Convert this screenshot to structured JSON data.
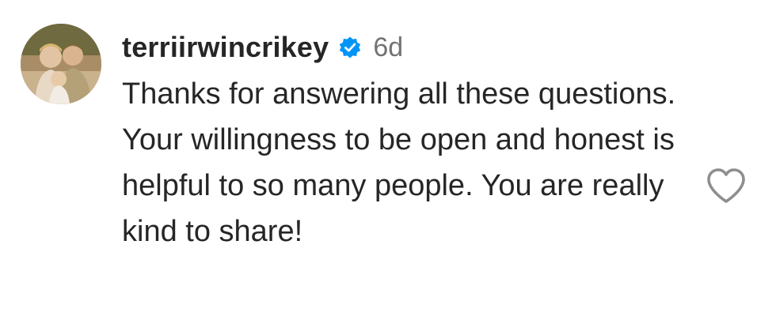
{
  "comment": {
    "username": "terriirwincrikey",
    "timestamp": "6d",
    "text": "Thanks for answering all these questions. Your willingness to be open and honest is helpful to so many people. You are really kind to share!",
    "verified_icon": "verified-badge-icon",
    "like_icon": "heart-outline-icon",
    "avatar_icon": "profile-photo"
  },
  "colors": {
    "verified_blue": "#0095f6",
    "text": "#262626",
    "timestamp": "#737373",
    "heart_outline": "#8e8e8e"
  }
}
